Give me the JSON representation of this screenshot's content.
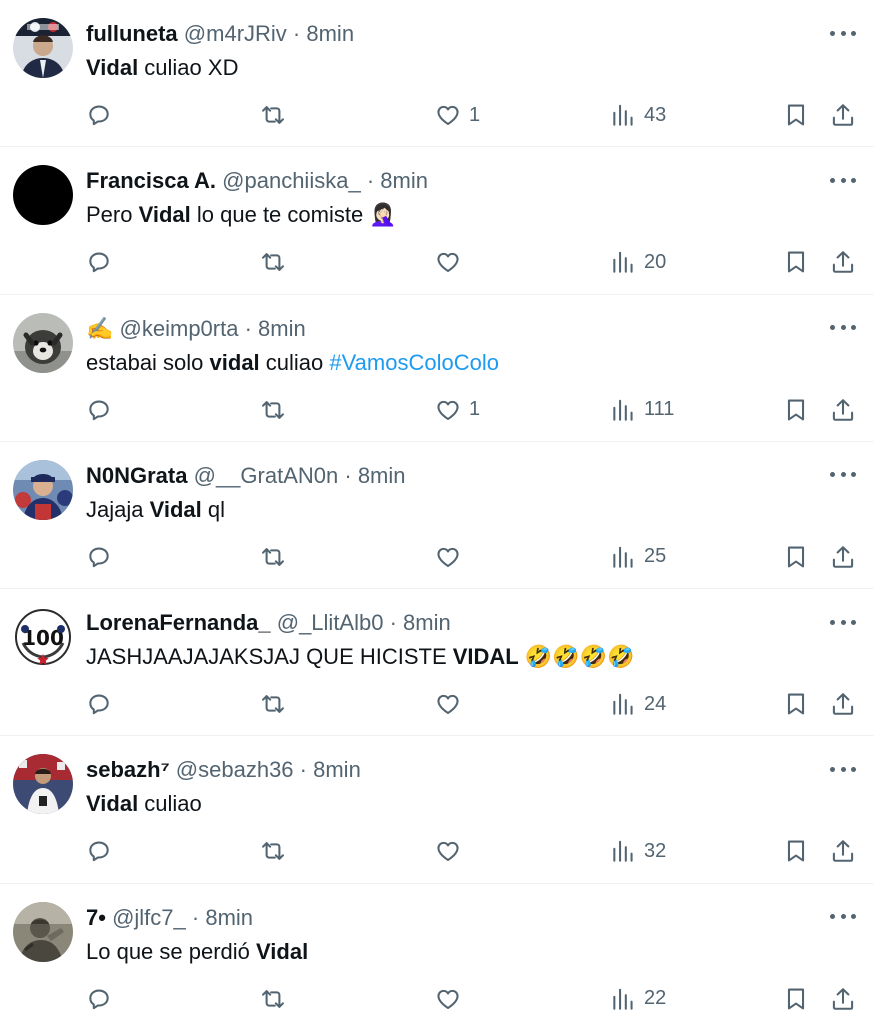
{
  "tweets": [
    {
      "name": "fulluneta",
      "handle": "@m4rJRiv",
      "time": "8min",
      "parts": [
        {
          "t": "Vidal",
          "b": true
        },
        {
          "t": " culiao XD"
        }
      ],
      "likes": "1",
      "views": "43",
      "avatar": "jersey-man-photo"
    },
    {
      "name": "Francisca A.",
      "handle": "@panchiiska_",
      "time": "8min",
      "parts": [
        {
          "t": "Pero "
        },
        {
          "t": "Vidal",
          "b": true
        },
        {
          "t": " lo que te comiste 🤦🏻‍♀️"
        }
      ],
      "likes": "",
      "views": "20",
      "avatar": "black-circle"
    },
    {
      "name": "✍️",
      "handle": "@keimp0rta",
      "time": "8min",
      "parts": [
        {
          "t": "estabai solo "
        },
        {
          "t": "vidal",
          "b": true
        },
        {
          "t": " culiao "
        },
        {
          "t": "#VamosColoColo",
          "h": true
        }
      ],
      "likes": "1",
      "views": "111",
      "avatar": "dog-photo"
    },
    {
      "name": "N0NGrata",
      "handle": "@__GratAN0n",
      "time": "8min",
      "parts": [
        {
          "t": "Jajaja "
        },
        {
          "t": "Vidal",
          "b": true
        },
        {
          "t": " ql"
        }
      ],
      "likes": "",
      "views": "25",
      "avatar": "fan-crowd-photo"
    },
    {
      "name": "LorenaFernanda_",
      "handle": "@_LlitAlb0",
      "time": "8min",
      "parts": [
        {
          "t": "JASHJAAJAJAKSJAJ QUE HICISTE "
        },
        {
          "t": "VIDAL",
          "b": true
        },
        {
          "t": " 🤣🤣🤣🤣"
        }
      ],
      "likes": "",
      "views": "24",
      "avatar": "club-100-logo"
    },
    {
      "name": "sebazh⁷",
      "handle": "@sebazh36",
      "time": "8min",
      "parts": [
        {
          "t": "Vidal",
          "b": true
        },
        {
          "t": " culiao"
        }
      ],
      "likes": "",
      "views": "32",
      "avatar": "player-photo"
    },
    {
      "name": "7•",
      "handle": "@jlfc7_",
      "time": "8min",
      "parts": [
        {
          "t": "Lo que se perdió "
        },
        {
          "t": "Vidal",
          "b": true
        }
      ],
      "likes": "",
      "views": "22",
      "avatar": "statue-photo"
    }
  ],
  "icons": {
    "reply": "reply-icon",
    "retweet": "retweet-icon",
    "like": "heart-icon",
    "views": "views-chart-icon",
    "bookmark": "bookmark-icon",
    "share": "share-icon",
    "more": "more-dots-icon"
  },
  "colors": {
    "text": "#0f1419",
    "secondary": "#536471",
    "link": "#1d9bf0",
    "divider": "#eff3f4"
  }
}
